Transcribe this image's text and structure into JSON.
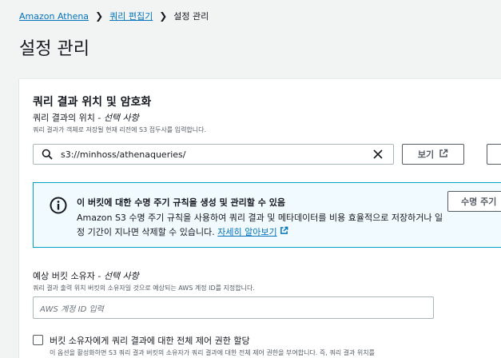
{
  "breadcrumb": {
    "items": [
      {
        "label": "Amazon Athena"
      },
      {
        "label": "쿼리 편집기"
      },
      {
        "label": "설정 관리"
      }
    ]
  },
  "page_title": "설정 관리",
  "query_results": {
    "title": "쿼리 결과 위치 및 암호화",
    "location_label": "쿼리 결과의 위치",
    "location_optional": "선택 사항",
    "location_desc": "쿼리 결과가 객체로 저장될 현재 리전에 S3 접두사를 입력합니다.",
    "location_value": "s3://minhoss/athenaqueries/",
    "view_button": "보기"
  },
  "info_alert": {
    "title": "이 버킷에 대한 수명 주기 규칙을 생성 및 관리할 수 있음",
    "body": "Amazon S3 수명 주기 규칙을 사용하여 쿼리 결과 및 메타데이터를 비용 효율적으로 저장하거나 일정 기간이 지나면 삭제할 수 있습니다.",
    "link_label": "자세히 알아보기",
    "button_label": "수명 주기"
  },
  "bucket_owner": {
    "label": "예상 버킷 소유자",
    "optional": "선택 사항",
    "desc": "쿼리 결과 출력 위치 버킷의 소유자일 것으로 예상되는 AWS 계정 ID를 지정합니다.",
    "placeholder": "AWS 계정 ID 입력"
  },
  "full_control": {
    "label": "버킷 소유자에게 쿼리 결과에 대한 전체 제어 권한 할당",
    "desc": "이 옵션을 활성화하면 S3 쿼리 결과 버킷의 소유자가 쿼리 결과에 대한 전체 제어 권한을 부여합니다. 즉, 쿼리 결과 위치를"
  },
  "colors": {
    "link": "#0073bb",
    "info_bg": "#f1faff",
    "info_border": "#00a1c9"
  }
}
